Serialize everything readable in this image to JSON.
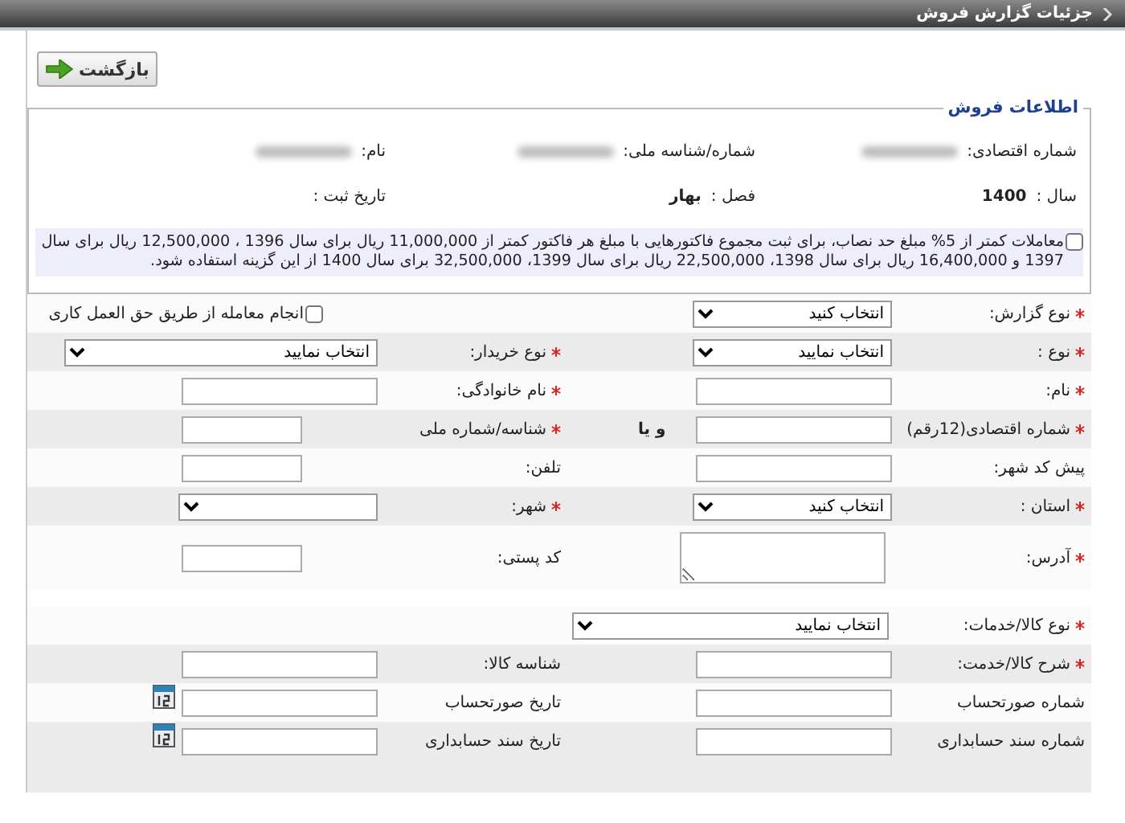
{
  "header": {
    "title": "جزئیات گزارش فروش"
  },
  "back_button": {
    "label": "بازگشت"
  },
  "section": {
    "title": "اطلاعات فروش",
    "info_rows": [
      [
        {
          "label": "شماره اقتصادی:",
          "redacted": true
        },
        {
          "label": "شماره/شناسه ملی:",
          "redacted": true
        },
        {
          "label": "نام:",
          "redacted": true
        }
      ],
      [
        {
          "label": "سال :",
          "value": "1400",
          "redacted": false
        },
        {
          "label": "فصل :",
          "value": "بهار",
          "redacted": false
        },
        {
          "label": "تاریخ ثبت :",
          "redacted": false
        }
      ]
    ],
    "notice": {
      "checked": false,
      "text": "معاملات کمتر از 5% مبلغ حد نصاب، برای ثبت مجموع فاکتورهایی با مبلغ هر فاکتور کمتر از 11,000,000 ریال برای سال 1396 ، 12,500,000 ریال برای سال 1397 و 16,400,000 ریال برای سال 1398، 22,500,000 ریال برای سال 1399، 32,500,000 برای سال 1400 از این گزینه استفاده شود."
    }
  },
  "rows": [
    {
      "cells": [
        {
          "label": "نوع گزارش:",
          "required": true,
          "control": {
            "kind": "select",
            "value": "انتخاب کنید"
          }
        },
        {
          "control": {
            "kind": "checkbox",
            "label": "انجام معامله از طریق حق العمل کاری",
            "checked": false
          }
        }
      ]
    },
    {
      "cells": [
        {
          "label": "نوع :",
          "required": true,
          "control": {
            "kind": "select",
            "value": "انتخاب نمایید"
          }
        },
        {
          "label": "نوع خریدار:",
          "required": true,
          "control": {
            "kind": "wide-select",
            "value": "انتخاب نمایید"
          }
        }
      ]
    },
    {
      "cells": [
        {
          "label": "نام:",
          "required": true,
          "control": {
            "kind": "input"
          }
        },
        {
          "label": "نام خانوادگی:",
          "required": true,
          "control": {
            "kind": "input"
          }
        }
      ]
    },
    {
      "middle": "و یا",
      "cells": [
        {
          "label": "شماره اقتصادی(12رقم)",
          "required": true,
          "control": {
            "kind": "input"
          }
        },
        {
          "label": "شناسه/شماره ملی",
          "required": true,
          "control": {
            "kind": "short-input"
          }
        }
      ]
    },
    {
      "cells": [
        {
          "label": "پیش کد شهر:",
          "required": false,
          "control": {
            "kind": "input"
          }
        },
        {
          "label": "تلفن:",
          "required": false,
          "control": {
            "kind": "short-input"
          }
        }
      ]
    },
    {
      "cells": [
        {
          "label": "استان :",
          "required": true,
          "control": {
            "kind": "select",
            "value": "انتخاب کنید"
          }
        },
        {
          "label": "شهر:",
          "required": true,
          "control": {
            "kind": "select"
          }
        }
      ]
    },
    {
      "cells": [
        {
          "label": "آدرس:",
          "required": true,
          "control": {
            "kind": "textarea"
          }
        },
        {
          "label": "کد پستی:",
          "required": false,
          "control": {
            "kind": "short-input"
          }
        }
      ]
    }
  ],
  "goods_rows": [
    {
      "cells": [
        {
          "label": "نوع کالا/خدمات:",
          "required": true,
          "control": {
            "kind": "span-select",
            "value": "انتخاب نمایید"
          }
        }
      ]
    },
    {
      "cells": [
        {
          "label": "شرح کالا/خدمت:",
          "required": true,
          "control": {
            "kind": "input"
          }
        },
        {
          "label": "شناسه کالا:",
          "required": false,
          "control": {
            "kind": "input"
          }
        }
      ]
    },
    {
      "cells": [
        {
          "label": "شماره صورتحساب",
          "required": false,
          "control": {
            "kind": "input"
          }
        },
        {
          "label": "تاریخ صورتحساب",
          "required": false,
          "control": {
            "kind": "date"
          }
        }
      ]
    },
    {
      "cells": [
        {
          "label": "شماره سند حسابداری",
          "required": false,
          "control": {
            "kind": "input"
          }
        },
        {
          "label": "تاریخ سند حسابداری",
          "required": false,
          "control": {
            "kind": "date"
          }
        }
      ]
    }
  ]
}
